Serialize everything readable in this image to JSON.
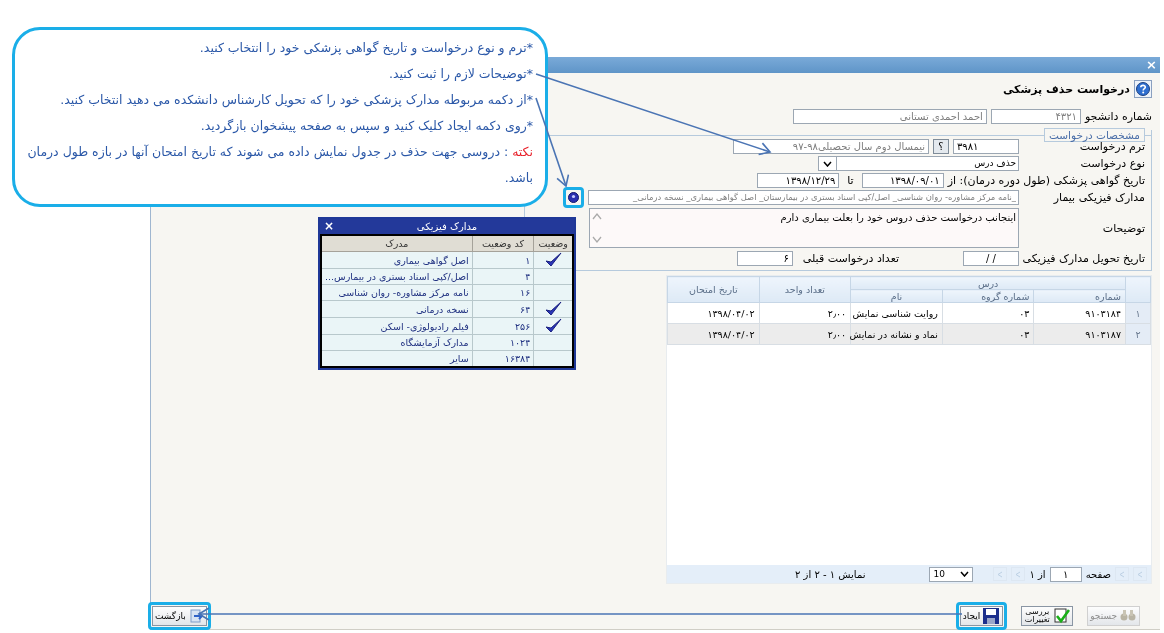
{
  "window": {
    "close": "×"
  },
  "header": {
    "title": "درخواست حذف پزشکی"
  },
  "student": {
    "label": "شماره دانشجو",
    "number": "۴۳۲۱",
    "name": "احمد احمدی تستانی"
  },
  "request": {
    "legend": "مشخصات درخواست",
    "term": {
      "label": "ترم درخواست",
      "code": "۳۹۸۱",
      "help": "؟",
      "value": "نیمسال دوم سال تحصیلی۹۸-۹۷"
    },
    "type": {
      "label": "نوع درخواست",
      "value": "حذف درس"
    },
    "certificate": {
      "label": "تاریخ گواهی پزشکی (طول دوره درمان): از",
      "from": "۱۳۹۸/۰۹/۰۱",
      "to_label": "تا",
      "to": "۱۳۹۸/۱۲/۲۹"
    },
    "documents": {
      "label": "مدارک فیزیکی بیمار",
      "value": "_نامه مرکز مشاوره- روان شناسی_ اصل/کپی اسناد بستری در بیمارستان_ اصل گواهی بیماری_ نسخه درمانی_",
      "highlighted": true
    },
    "description": {
      "label": "توضیحات",
      "value": "اینجانب درخواست حذف دروس خود را بعلت بیماری دارم"
    },
    "delivery": {
      "label": "تاریخ تحویل مدارک فیزیکی",
      "value": "/     /"
    },
    "previous": {
      "label": "تعداد درخواست قبلی",
      "value": "۶"
    }
  },
  "courses": {
    "group_header": "درس",
    "columns": [
      "شماره",
      "شماره گروه",
      "نام",
      "تعداد واحد",
      "تاریخ امتحان"
    ],
    "rows": [
      {
        "index": "۱",
        "number": "۹۱۰۳۱۸۴",
        "group": "۰۳",
        "name": "روایت شناسی نمایش",
        "units": "۲٫۰۰",
        "exam_date": "۱۳۹۸/۰۴/۰۲"
      },
      {
        "index": "۲",
        "number": "۹۱۰۳۱۸۷",
        "group": "۰۳",
        "name": "نماد و نشانه در نمایش",
        "units": "۲٫۰۰",
        "exam_date": "۱۳۹۸/۰۴/۰۲"
      }
    ]
  },
  "pager": {
    "page_label": "صفحه",
    "page": "۱",
    "of": "از ۱",
    "page_size": "10",
    "summary": "نمایش ۱ - ۲ از ۲"
  },
  "buttons": [
    {
      "kind": "search",
      "label": "جستجو",
      "disabled": true,
      "highlighted": false
    },
    {
      "kind": "review",
      "label": "بررسی تغییرات",
      "disabled": false,
      "highlighted": false
    },
    {
      "kind": "create",
      "label": "ایجاد",
      "disabled": false,
      "highlighted": true
    }
  ],
  "back": {
    "label": "بازگشت",
    "highlighted": true
  },
  "popup": {
    "title": "مدارک فیزیکی",
    "close": "×",
    "columns": [
      "وضعیت",
      "کد وضعیت",
      "مدرک"
    ],
    "rows": [
      {
        "checked": true,
        "code": "۱",
        "name": "اصل گواهی بیماری"
      },
      {
        "checked": false,
        "code": "۴",
        "name": "اصل/کپی اسناد بستری در بیمارس..."
      },
      {
        "checked": false,
        "code": "۱۶",
        "name": "نامه مرکز مشاوره- روان شناسی"
      },
      {
        "checked": true,
        "code": "۶۴",
        "name": "نسخه درمانی"
      },
      {
        "checked": true,
        "code": "۲۵۶",
        "name": "فیلم رادیولوژی- اسکن"
      },
      {
        "checked": false,
        "code": "۱۰۲۴",
        "name": "مدارک آزمایشگاه"
      },
      {
        "checked": false,
        "code": "۱۶۳۸۴",
        "name": "سایر"
      }
    ]
  },
  "callout": {
    "lines": [
      {
        "kind": "bullet",
        "text": "*ترم و نوع درخواست  و تاریخ گواهی پزشکی خود را انتخاب کنید."
      },
      {
        "kind": "bullet",
        "text": "*توضیحات لازم را ثبت کنید."
      },
      {
        "kind": "bullet",
        "text": "*از دکمه مربوطه مدارک پزشکی خود را که تحویل کارشناس دانشکده می دهید انتخاب کنید."
      },
      {
        "kind": "bullet",
        "text": "*روی دکمه ایجاد کلیک کنید و سپس به صفحه پیشخوان بازگردید."
      },
      {
        "kind": "note",
        "label": "نکته",
        "text": " : دروسی جهت حذف در جدول نمایش داده می شوند که تاریخ امتحان آنها در بازه  طول درمان باشد."
      }
    ]
  }
}
